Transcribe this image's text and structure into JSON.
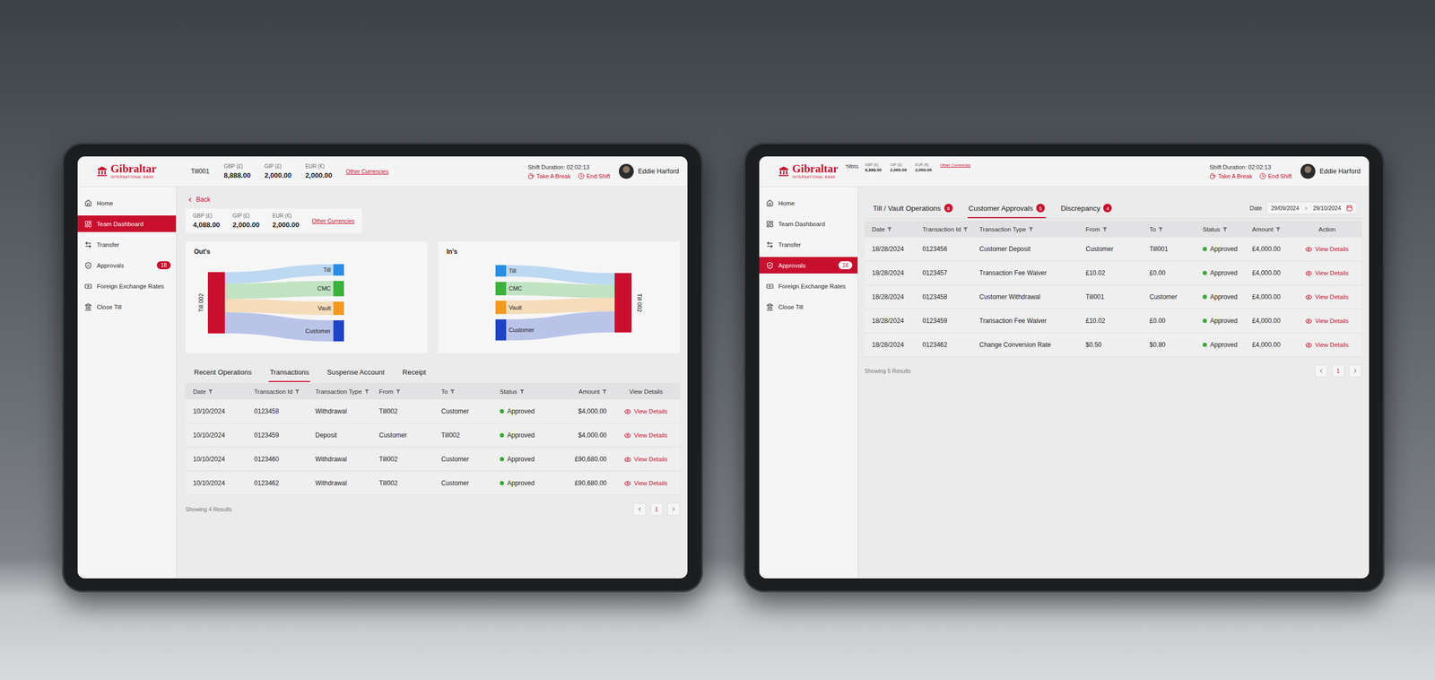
{
  "tablets": [
    {
      "kind": "team-dashboard",
      "logo": {
        "name": "Gibraltar",
        "subtitle": "INTERNATIONAL BANK"
      },
      "header": {
        "kind": "full",
        "till": "Till001",
        "currencies": [
          {
            "label": "GBP (£)",
            "value": "8,888.00"
          },
          {
            "label": "GIP (£)",
            "value": "2,000.00"
          },
          {
            "label": "EUR (€)",
            "value": "2,000.00"
          }
        ],
        "other": "Other Currencies",
        "shift": "Shift Duration: 02:02:13",
        "actions": [
          "Take A Break",
          "End Shift"
        ],
        "user": "Eddie Harford"
      },
      "sidebar": {
        "items": [
          {
            "label": "Home",
            "selected": false
          },
          {
            "label": "Team Dashboard",
            "selected": true
          },
          {
            "label": "Transfer",
            "selected": false
          },
          {
            "label": "Approvals",
            "selected": false,
            "badge": "18"
          },
          {
            "label": "Foreign Exchange Rates",
            "selected": false
          },
          {
            "label": "Close Till",
            "selected": false
          }
        ]
      },
      "back": "Back",
      "summary": {
        "currencies": [
          {
            "label": "GBP (£)",
            "value": "4,088.00"
          },
          {
            "label": "GIP (£)",
            "value": "2,000.00"
          },
          {
            "label": "EUR (€)",
            "value": "2,000.00"
          }
        ],
        "other": "Other Currencies"
      },
      "charts": [
        {
          "title": "Out's",
          "node": "Till 002",
          "direction": "out",
          "flows": [
            {
              "label": "Till",
              "value": 12,
              "color": "#2a8de4"
            },
            {
              "label": "CMC",
              "value": 16,
              "color": "#3bb23b"
            },
            {
              "label": "Vault",
              "value": 14,
              "color": "#f39a1e"
            },
            {
              "label": "Customer",
              "value": 22,
              "color": "#1f43c6"
            }
          ]
        },
        {
          "title": "In's",
          "node": "Till 002",
          "direction": "in",
          "flows": [
            {
              "label": "Till",
              "value": 12,
              "color": "#2a8de4"
            },
            {
              "label": "CMC",
              "value": 14,
              "color": "#3bb23b"
            },
            {
              "label": "Vault",
              "value": 14,
              "color": "#f39a1e"
            },
            {
              "label": "Customer",
              "value": 22,
              "color": "#1f43c6"
            }
          ]
        }
      ],
      "tabs": [
        {
          "label": "Recent Operations",
          "selected": false
        },
        {
          "label": "Transactions",
          "selected": true
        },
        {
          "label": "Suspense Account",
          "selected": false
        },
        {
          "label": "Receipt",
          "selected": false
        }
      ],
      "table": {
        "columns": [
          {
            "label": "Date",
            "kind": "text",
            "filter": true
          },
          {
            "label": "Transaction Id",
            "kind": "text",
            "filter": true
          },
          {
            "label": "Transaction Type",
            "kind": "text",
            "filter": true
          },
          {
            "label": "From",
            "kind": "text",
            "filter": true
          },
          {
            "label": "To",
            "kind": "text",
            "filter": true
          },
          {
            "label": "Status",
            "kind": "status",
            "filter": true
          },
          {
            "label": "Amount",
            "kind": "amount",
            "filter": true
          },
          {
            "label": "View Details",
            "kind": "link",
            "filter": false
          }
        ],
        "rows": [
          [
            "10/10/2024",
            "0123458",
            "Withdrawal",
            "Till002",
            "Customer",
            "Approved",
            "$4,000.00",
            "View Details"
          ],
          [
            "10/10/2024",
            "0123459",
            "Deposit",
            "Customer",
            "Till002",
            "Approved",
            "$4,000.00",
            "View Details"
          ],
          [
            "10/10/2024",
            "0123460",
            "Withdrawal",
            "Till002",
            "Customer",
            "Approved",
            "£90,680.00",
            "View Details"
          ],
          [
            "10/10/2024",
            "0123462",
            "Withdrawal",
            "Till002",
            "Customer",
            "Approved",
            "£90,680.00",
            "View Details"
          ]
        ]
      },
      "footer": "Showing 4 Results",
      "pagination": {
        "pages": [
          {
            "label": "1",
            "selected": true
          }
        ]
      }
    },
    {
      "kind": "approvals",
      "logo": {
        "name": "Gibraltar",
        "subtitle": "INTERNATIONAL BANK"
      },
      "header": {
        "kind": "compact",
        "till": "Till001",
        "currencies": [
          {
            "label": "GBP (£)",
            "value": "8,888.00"
          },
          {
            "label": "GIP (£)",
            "value": "2,000.00"
          },
          {
            "label": "EUR (€)",
            "value": "2,000.00"
          }
        ],
        "other": "Other Currencies",
        "shift": "Shift Duration: 02:02:13",
        "actions": [
          "Take A Break",
          "End Shift"
        ],
        "user": "Eddie Harford"
      },
      "sidebar": {
        "items": [
          {
            "label": "Home",
            "selected": false
          },
          {
            "label": "Team Dashboard",
            "selected": false
          },
          {
            "label": "Transfer",
            "selected": false
          },
          {
            "label": "Approvals",
            "selected": true,
            "badge": "18"
          },
          {
            "label": "Foreign Exchange Rates",
            "selected": false
          },
          {
            "label": "Close Till",
            "selected": false
          }
        ]
      },
      "tabs": [
        {
          "label": "Till / Vault Operations",
          "badge": "9",
          "selected": false
        },
        {
          "label": "Customer Approvals",
          "badge": "5",
          "selected": true
        },
        {
          "label": "Discrepancy",
          "badge": "4",
          "selected": false
        }
      ],
      "date_filter": {
        "label": "Date",
        "from": "29/09/2024",
        "separator": ">",
        "to": "29/10/2024"
      },
      "table": {
        "columns": [
          {
            "label": "Date",
            "kind": "text",
            "filter": true
          },
          {
            "label": "Transaction Id",
            "kind": "text",
            "filter": true
          },
          {
            "label": "Transaction Type",
            "kind": "text",
            "filter": true
          },
          {
            "label": "From",
            "kind": "text",
            "filter": true
          },
          {
            "label": "To",
            "kind": "text",
            "filter": true
          },
          {
            "label": "Status",
            "kind": "status",
            "filter": true
          },
          {
            "label": "Amount",
            "kind": "text",
            "filter": true
          },
          {
            "label": "Action",
            "kind": "link",
            "filter": false
          }
        ],
        "rows": [
          [
            "18/28/2024",
            "0123456",
            "Customer Deposit",
            "Customer",
            "Till001",
            "Approved",
            "£4,000.00",
            "View Details"
          ],
          [
            "18/28/2024",
            "0123457",
            "Transaction Fee Waiver",
            "£10.02",
            "£0.00",
            "Approved",
            "£4,000.00",
            "View Details"
          ],
          [
            "18/28/2024",
            "0123458",
            "Customer Withdrawal",
            "Till001",
            "Customer",
            "Approved",
            "£4,000.00",
            "View Details"
          ],
          [
            "18/28/2024",
            "0123459",
            "Transaction Fee Waiver",
            "£10.02",
            "£0.00",
            "Approved",
            "£4,000.00",
            "View Details"
          ],
          [
            "18/28/2024",
            "0123462",
            "Change Conversion Rate",
            "$0.50",
            "$0.80",
            "Approved",
            "£4,000.00",
            "View Details"
          ]
        ]
      },
      "footer": "Showing 5 Results",
      "pagination": {
        "pages": [
          {
            "label": "1",
            "selected": true
          }
        ]
      }
    }
  ]
}
